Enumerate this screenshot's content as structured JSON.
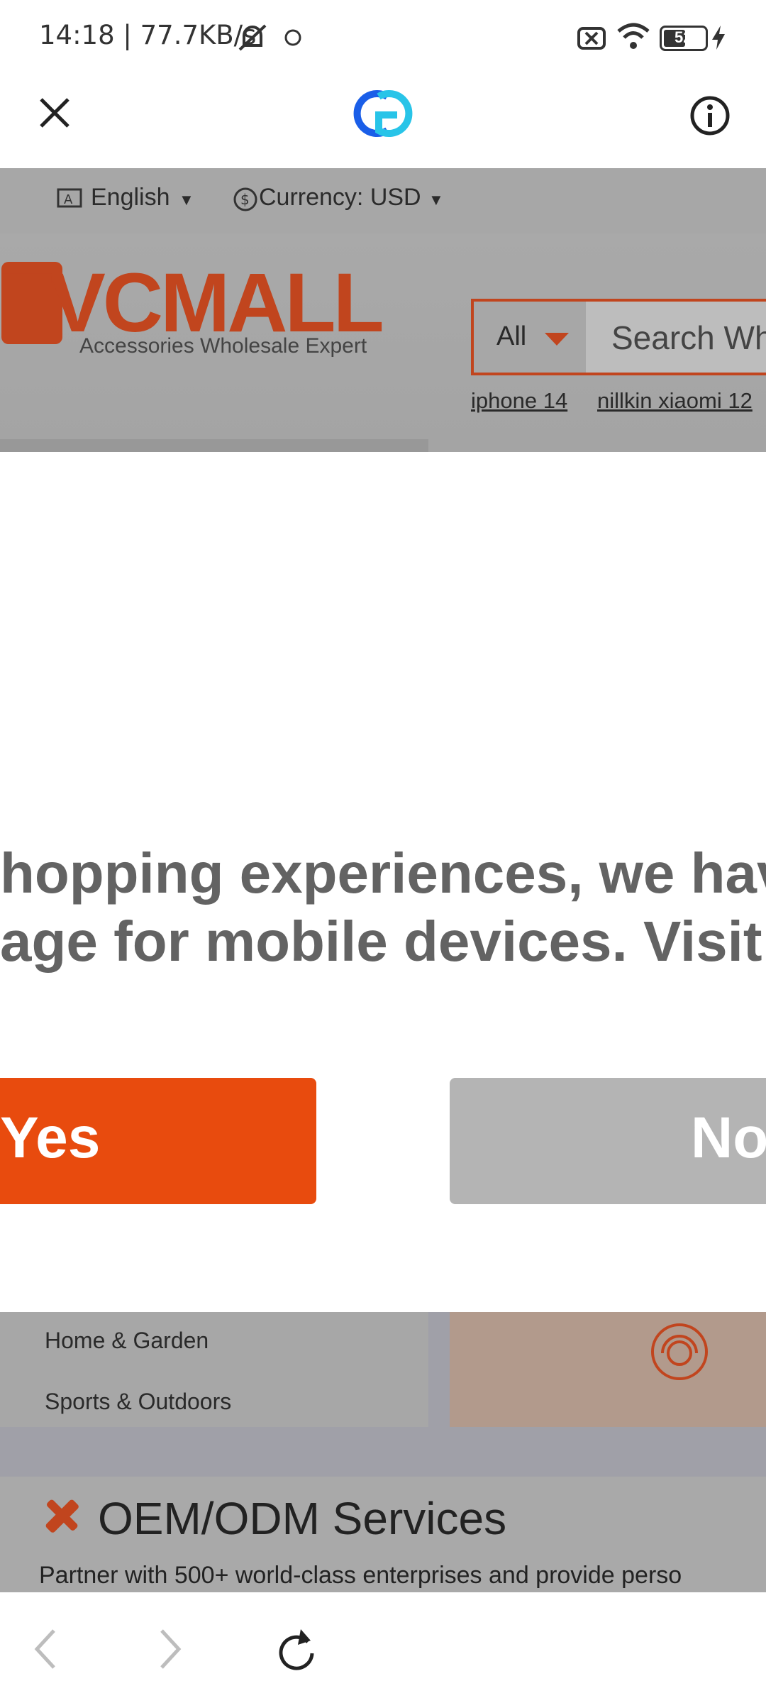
{
  "status_bar": {
    "time_speed": "14:18 | 77.7KB/s",
    "battery": "52"
  },
  "browser_header": {
    "close_label": "close",
    "info_label": "info"
  },
  "site": {
    "language": "English",
    "currency": "Currency: USD",
    "logo_text": "TVCMALL",
    "logo_tagline": "Accessories Wholesale Expert",
    "search_category": "All",
    "search_placeholder": "Search Wh",
    "suggestions": [
      "iphone 14",
      "nillkin xiaomi 12"
    ]
  },
  "modal": {
    "line1": "hopping experiences, we have",
    "line2": "age for mobile devices. Visit th",
    "yes_label": "Yes",
    "no_label": "No"
  },
  "menu": {
    "items": [
      "Home & Garden",
      "Sports & Outdoors"
    ]
  },
  "oem": {
    "title": "OEM/ODM Services",
    "subtitle": "Partner with 500+ world-class enterprises and provide perso"
  },
  "colors": {
    "accent": "#e84b0e",
    "overlay_grey": "#a9a9a9"
  }
}
